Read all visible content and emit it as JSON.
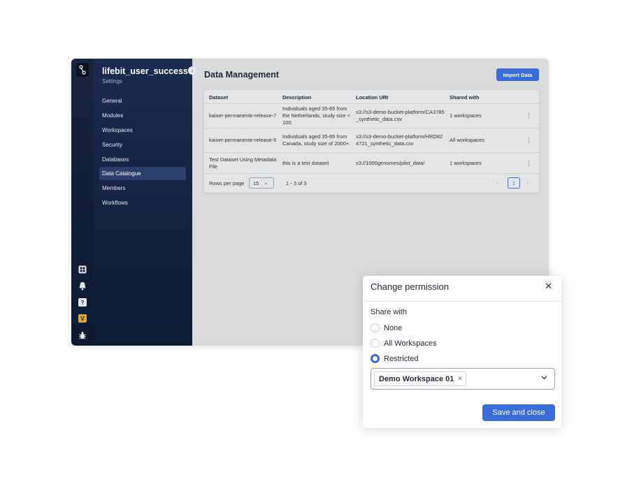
{
  "sidebar": {
    "org_name": "lifebit_user_success",
    "org_sub": "Settings",
    "items": [
      {
        "label": "General"
      },
      {
        "label": "Modules"
      },
      {
        "label": "Workspaces"
      },
      {
        "label": "Security"
      },
      {
        "label": "Databases"
      },
      {
        "label": "Data Catalogue",
        "active": true
      },
      {
        "label": "Members"
      },
      {
        "label": "Workflows"
      }
    ]
  },
  "rail": {
    "icons": [
      "apps-grid-icon",
      "bell-icon",
      "help-icon",
      "user-avatar-icon",
      "bug-icon"
    ],
    "help_glyph": "?",
    "avatar_letter": "V",
    "accent": "#e0a63a"
  },
  "main": {
    "title": "Data Management",
    "import_label": "Import Data"
  },
  "table": {
    "headers": [
      "Dataset",
      "Description",
      "Location URI",
      "Shared with"
    ],
    "rows": [
      {
        "dataset": "kaiser-permanente-release-7",
        "description": "Individuals aged 35-65 from the Netherlands, study size < 100.",
        "location": "s3://s3-demo-bucket-platform/CA3785_synthetic_data.csv",
        "shared": "1 workspaces"
      },
      {
        "dataset": "kaiser-permanente-release-5",
        "description": "Individuals aged 35-65 from Canada, study size of 2000+.",
        "location": "s3://s3-demo-bucket-platform/HRD824721_synthetic_data.csv",
        "shared": "All workspaces"
      },
      {
        "dataset": "Test Dataset Using Metadata File",
        "description": "this is a test dataset",
        "location": "s3://1000genomes/pilot_data/",
        "shared": "1 workspaces"
      }
    ],
    "rows_per_page_label": "Rows per page",
    "rows_per_page_value": "15",
    "range": "1 - 3 of 3",
    "current_page": "1"
  },
  "modal": {
    "title": "Change permission",
    "share_label": "Share with",
    "options": [
      {
        "label": "None",
        "checked": false
      },
      {
        "label": "All Workspaces",
        "checked": false
      },
      {
        "label": "Restricted",
        "checked": true
      }
    ],
    "selected_workspace": "Demo Workspace 01",
    "save_label": "Save and close"
  },
  "colors": {
    "primary": "#3b6dd8",
    "sidebar_top": "#1b2b4f",
    "sidebar_bottom": "#0e1b35"
  }
}
